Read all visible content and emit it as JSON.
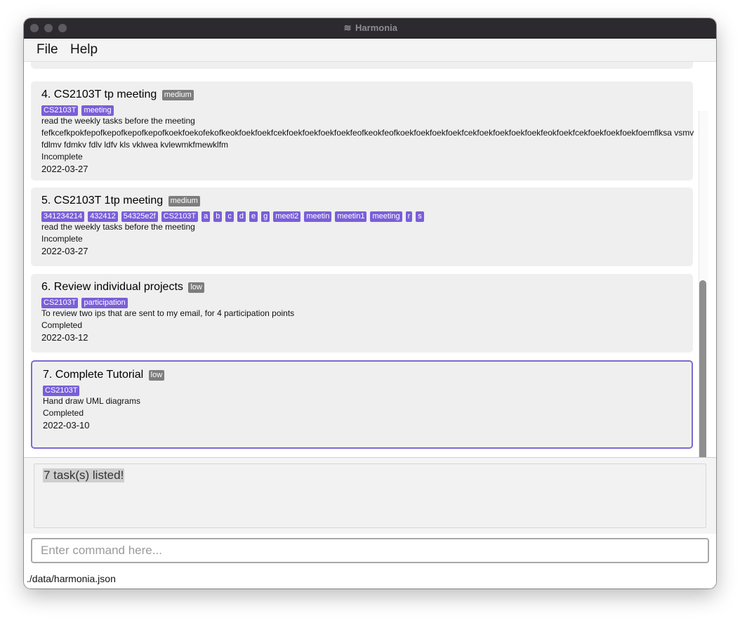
{
  "window": {
    "title": "Harmonia"
  },
  "menu": {
    "file": "File",
    "help": "Help"
  },
  "tasks": [
    {
      "index": "4.",
      "name": "CS2103T tp meeting",
      "priority": "medium",
      "tags": [
        "CS2103T",
        "meeting"
      ],
      "description_lines": [
        "read the weekly tasks before the meeting",
        "fefkcefkpokfepofkepofkepofkepofkoekfoekofekofkeokfoekfoekfcekfoekfoekfoekfoekfeofkeokfeofkoekfoekfoekfoekfcekfoekfoekfoekfoekfeokfoekfcekfoekfoekfoekfoemflksa vsmv",
        "fdlmv fdmkv fdlv ldfv kls vklwea kvlewmkfmewklfm"
      ],
      "status": "Incomplete",
      "date": "2022-03-27"
    },
    {
      "index": "5.",
      "name": "CS2103T 1tp meeting",
      "priority": "medium",
      "tags": [
        "341234214",
        "432412",
        "54325e2f",
        "CS2103T",
        "a",
        "b",
        "c",
        "d",
        "e",
        "g",
        "meeti2",
        "meetin",
        "meetin1",
        "meeting",
        "r",
        "s"
      ],
      "description_lines": [
        "read the weekly tasks before the meeting"
      ],
      "status": "Incomplete",
      "date": "2022-03-27"
    },
    {
      "index": "6.",
      "name": "Review individual projects",
      "priority": "low",
      "tags": [
        "CS2103T",
        "participation"
      ],
      "description_lines": [
        "To review two ips that are sent to my email, for 4 participation points"
      ],
      "status": "Completed",
      "date": "2022-03-12"
    },
    {
      "index": "7.",
      "name": "Complete Tutorial",
      "priority": "low",
      "tags": [
        "CS2103T"
      ],
      "description_lines": [
        "Hand draw UML diagrams"
      ],
      "status": "Completed",
      "date": "2022-03-10"
    }
  ],
  "result": {
    "message": "7 task(s) listed!"
  },
  "command": {
    "placeholder": "Enter command here..."
  },
  "status_bar": {
    "path": "./data/harmonia.json"
  },
  "colors": {
    "tag": "#7a5fd8",
    "priority": "#7d7d7d",
    "selected_border": "#7b6ad6",
    "card_bg": "#efefef"
  }
}
